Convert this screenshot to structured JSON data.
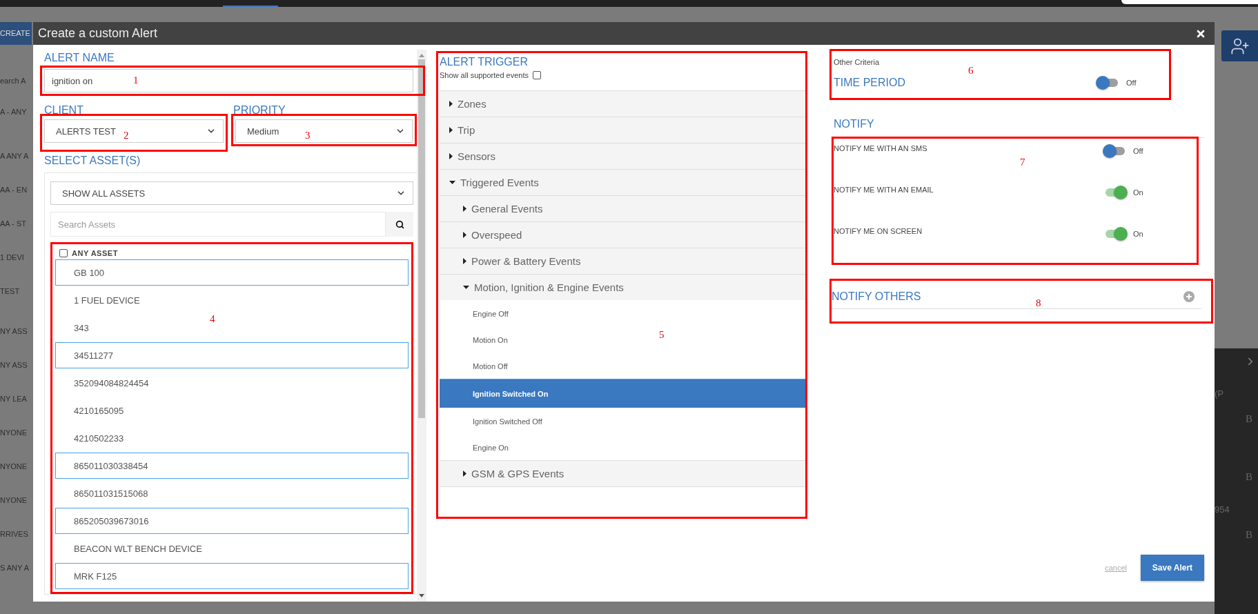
{
  "background": {
    "create_button": "CREATE",
    "search_text": "earch A",
    "rows": [
      "A - ANY",
      "A ANY A",
      "AA - EN",
      "AA - ST",
      "1 DEVI",
      "TEST",
      "NY ASS",
      "NY ASS",
      "NY LEA",
      "NYONE",
      "NYONE",
      "NYONE",
      "RRIVES",
      "S ANY A"
    ],
    "side_texts": [
      "(P",
      "B",
      "B",
      "954",
      "B"
    ]
  },
  "modal": {
    "title": "Create a custom Alert",
    "alert_name": {
      "label": "ALERT NAME",
      "value": "ignition on",
      "marker": "1"
    },
    "client": {
      "label": "CLIENT",
      "value": "ALERTS TEST",
      "marker": "2"
    },
    "priority": {
      "label": "PRIORITY",
      "value": "Medium",
      "marker": "3"
    },
    "assets": {
      "label": "SELECT ASSET(S)",
      "filter": "SHOW ALL ASSETS",
      "search_placeholder": "Search Assets",
      "marker": "4",
      "any_asset": {
        "label": "ANY ASSET",
        "checked": false
      },
      "items": [
        {
          "name": "GB 100",
          "selected": true
        },
        {
          "name": "1 FUEL DEVICE",
          "selected": false
        },
        {
          "name": "343",
          "selected": false
        },
        {
          "name": "34511277",
          "selected": true
        },
        {
          "name": "352094084824454",
          "selected": false
        },
        {
          "name": "4210165095",
          "selected": false
        },
        {
          "name": "4210502233",
          "selected": false
        },
        {
          "name": "865011030338454",
          "selected": true
        },
        {
          "name": "865011031515068",
          "selected": false
        },
        {
          "name": "865205039673016",
          "selected": true
        },
        {
          "name": "BEACON WLT BENCH DEVICE",
          "selected": false
        },
        {
          "name": "MRK F125",
          "selected": true
        }
      ]
    },
    "trigger": {
      "title": "ALERT TRIGGER",
      "show_all": {
        "label": "Show all supported events",
        "checked": false
      },
      "marker": "5",
      "tree": [
        {
          "kind": "group",
          "label": "Zones",
          "expanded": false
        },
        {
          "kind": "group",
          "label": "Trip",
          "expanded": false
        },
        {
          "kind": "group",
          "label": "Sensors",
          "expanded": false
        },
        {
          "kind": "group",
          "label": "Triggered Events",
          "expanded": true,
          "children": [
            {
              "kind": "group",
              "label": "General Events",
              "expanded": false
            },
            {
              "kind": "group",
              "label": "Overspeed",
              "expanded": false
            },
            {
              "kind": "group",
              "label": "Power & Battery Events",
              "expanded": false
            },
            {
              "kind": "group",
              "label": "Motion, Ignition & Engine Events",
              "expanded": true,
              "children": [
                {
                  "kind": "event",
                  "label": "Engine Off",
                  "selected": false
                },
                {
                  "kind": "event",
                  "label": "Motion On",
                  "selected": false
                },
                {
                  "kind": "event",
                  "label": "Motion Off",
                  "selected": false
                },
                {
                  "kind": "event",
                  "label": "Ignition Switched On",
                  "selected": true
                },
                {
                  "kind": "event",
                  "label": "Ignition Switched Off",
                  "selected": false
                },
                {
                  "kind": "event",
                  "label": "Engine On",
                  "selected": false
                }
              ]
            },
            {
              "kind": "group",
              "label": "GSM & GPS Events",
              "expanded": false
            }
          ]
        }
      ]
    },
    "other_criteria": {
      "caption": "Other Criteria",
      "title": "TIME PERIOD",
      "on": false,
      "state_text": "Off",
      "marker": "6"
    },
    "notify": {
      "title": "NOTIFY",
      "marker": "7",
      "rows": [
        {
          "label": "NOTIFY ME WITH AN SMS",
          "on": false,
          "state_text": "Off"
        },
        {
          "label": "NOTIFY ME WITH AN EMAIL",
          "on": true,
          "state_text": "On"
        },
        {
          "label": "NOTIFY ME ON SCREEN",
          "on": true,
          "state_text": "On"
        }
      ]
    },
    "notify_others": {
      "title": "NOTIFY OTHERS",
      "marker": "8"
    },
    "footer": {
      "cancel": "cancel",
      "save": "Save Alert"
    }
  }
}
